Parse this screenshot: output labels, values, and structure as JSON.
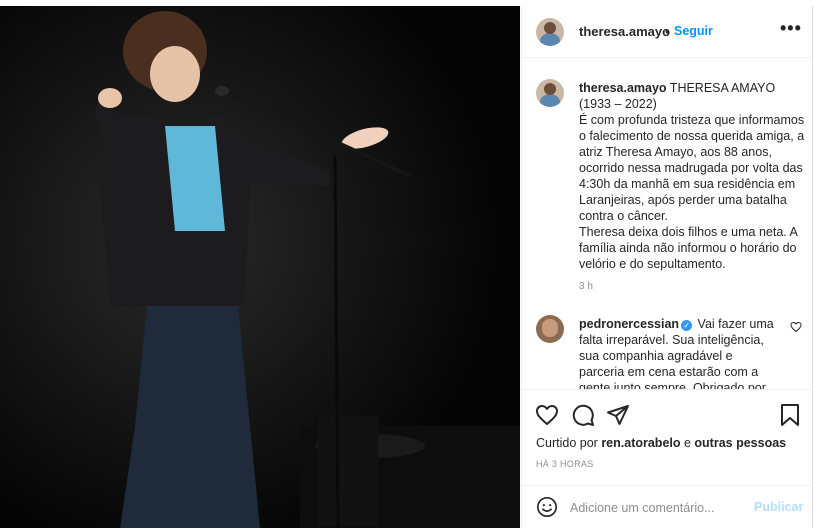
{
  "post": {
    "username": "theresa.amayo",
    "follow_separator": "•",
    "follow_label": "Seguir",
    "more_label": "•••"
  },
  "caption": {
    "username": "theresa.amayo",
    "text": " THERESA AMAYO (1933 – 2022)\nÉ com profunda tristeza que informamos o falecimento de nossa querida amiga, a atriz Theresa Amayo, aos 88 anos, ocorrido nessa madrugada por volta das 4:30h da manhã em sua residência em Laranjeiras, após perder uma batalha contra o câncer.\nTheresa deixa dois filhos e uma neta. A família ainda não informou o horário do velório e do sepultamento.",
    "time": "3 h"
  },
  "comment": {
    "username": "pedronercessian",
    "verified_mark": "✓",
    "text": "Vai fazer uma falta irreparável. Sua inteligência, sua companhia agradável e parceria em cena estarão com a gente junto sempre. Obrigado por tudo."
  },
  "likes": {
    "prefix": "Curtido por ",
    "user": "ren.atorabelo",
    "suffix": " e ",
    "others": "outras pessoas"
  },
  "timestamp": "HÁ 3 HORAS",
  "add_comment": {
    "placeholder": "Adicione um comentário...",
    "publish_label": "Publicar"
  },
  "icons": {
    "like": "heart-icon",
    "comment": "comment-icon",
    "share": "send-icon",
    "save": "bookmark-icon",
    "emoji": "emoji-icon"
  },
  "colors": {
    "link_blue": "#0095f6",
    "publish_disabled": "#b2dffc",
    "muted": "#8e8e8e"
  }
}
